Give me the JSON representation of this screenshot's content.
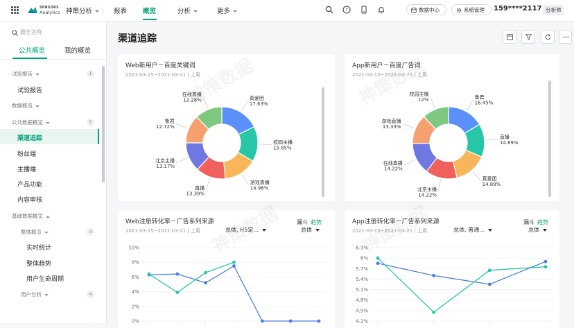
{
  "colors": {
    "accent": "#00a27a",
    "blue": "#5b8ff9",
    "teal": "#27c6a9",
    "orange": "#f8b65a",
    "red": "#f0605d",
    "purple": "#6f77e0",
    "salmon": "#f7a06f",
    "green": "#7ec880"
  },
  "header": {
    "logo_line1": "SENSORS",
    "logo_line2": "Analytics",
    "project": "神策分析",
    "nav": [
      "报表",
      "概览",
      "分析",
      "更多"
    ],
    "icons": [
      "search-icon",
      "help-icon",
      "mobile-icon",
      "bell-icon"
    ],
    "data_center": "数据中心",
    "sys_admin": "系统管理",
    "phone": "159****2117",
    "role": "分析师"
  },
  "sidebar": {
    "search_placeholder": "概览名称",
    "tabs": [
      "公共概览",
      "我的概览"
    ],
    "groups": [
      {
        "label": "试验报告",
        "count": "1"
      },
      {
        "label": "数据概览"
      },
      {
        "label": "公共数据概览",
        "count": "5"
      },
      {
        "label": "基础数据概览"
      },
      {
        "label": "整体概览",
        "count": "3"
      },
      {
        "label": "用户分析",
        "count": "4"
      }
    ],
    "items": [
      "试验报告",
      "渠道追踪",
      "粉丝端",
      "主播端",
      "产品功能",
      "内容审核",
      "实时统计",
      "整体趋势",
      "用户生命周期"
    ]
  },
  "main": {
    "title": "渠道追踪",
    "watermark": "神策数据"
  },
  "cards": [
    {
      "title": "Web新用户－百度关键词",
      "date": "2021-03-15~2021-03-21 | 上周"
    },
    {
      "title": "App新用户－百度广告词",
      "date": "2021-03-15~2021-03-21 | 上周"
    },
    {
      "title": "Web注册转化率－广告系列来源",
      "date": "2021-03-15~2021-03-21 | 上周",
      "mode1": "漏斗",
      "mode2": "趋势",
      "filter1": "总体, H5定…",
      "filter2": "总体"
    },
    {
      "title": "App注册转化率－广告系列来源",
      "date": "2021-03-15~2021-03-21 | 上周",
      "mode1": "漏斗",
      "mode2": "趋势",
      "filter1": "总体, 普通…",
      "filter2": "总体"
    }
  ],
  "chart_data": [
    {
      "type": "pie",
      "donut": true,
      "title": "Web新用户－百度关键词",
      "slices": [
        {
          "label": "真爱团",
          "value": 17.63,
          "color": "#5b8ff9"
        },
        {
          "label": "校园主播",
          "value": 15.85,
          "color": "#27c6a9"
        },
        {
          "label": "游戏直播",
          "value": 14.96,
          "color": "#f8b65a"
        },
        {
          "label": "直播",
          "value": 13.39,
          "color": "#f0605d"
        },
        {
          "label": "北京主播",
          "value": 13.17,
          "color": "#6f77e0"
        },
        {
          "label": "鲁君",
          "value": 12.72,
          "color": "#f7a06f"
        },
        {
          "label": "在线直播",
          "value": 12.28,
          "color": "#7ec880"
        }
      ]
    },
    {
      "type": "pie",
      "donut": true,
      "title": "App新用户－百度广告词",
      "slices": [
        {
          "label": "鲁君",
          "value": 16.45,
          "color": "#5b8ff9"
        },
        {
          "label": "直播",
          "value": 14.89,
          "color": "#27c6a9"
        },
        {
          "label": "真爱团",
          "value": 14.89,
          "color": "#f8b65a"
        },
        {
          "label": "北京主播",
          "value": 14.22,
          "color": "#f0605d"
        },
        {
          "label": "在线直播",
          "value": 14.22,
          "color": "#6f77e0"
        },
        {
          "label": "游戏直播",
          "value": 13.33,
          "color": "#f7a06f"
        },
        {
          "label": "校园主播",
          "value": 12,
          "color": "#7ec880"
        }
      ]
    },
    {
      "type": "line",
      "title": "Web注册转化率－广告系列来源",
      "ylim": [
        0,
        10
      ],
      "yticks": [
        "10%",
        "8%",
        "6%",
        "4%",
        "2%",
        "0%"
      ],
      "series": [
        {
          "color": "#4a7ee0",
          "values": [
            6.3,
            6.4,
            5.2,
            7.5,
            0,
            0,
            0
          ]
        },
        {
          "color": "#27c6a9",
          "values": [
            6.4,
            3.9,
            6.6,
            8
          ]
        }
      ]
    },
    {
      "type": "line",
      "title": "App注册转化率－广告系列来源",
      "ylim": [
        4.2,
        6.3
      ],
      "yticks": [
        "6.3%",
        "6%",
        "5.7%",
        "5.4%",
        "5.1%",
        "4.8%",
        "4.5%",
        "4.2%"
      ],
      "series": [
        {
          "color": "#4a7ee0",
          "values": [
            5.85,
            5.5,
            5.25,
            5.9
          ]
        },
        {
          "color": "#27c6a9",
          "values": [
            6.0,
            4.45,
            5.65,
            5.75
          ]
        }
      ]
    }
  ]
}
